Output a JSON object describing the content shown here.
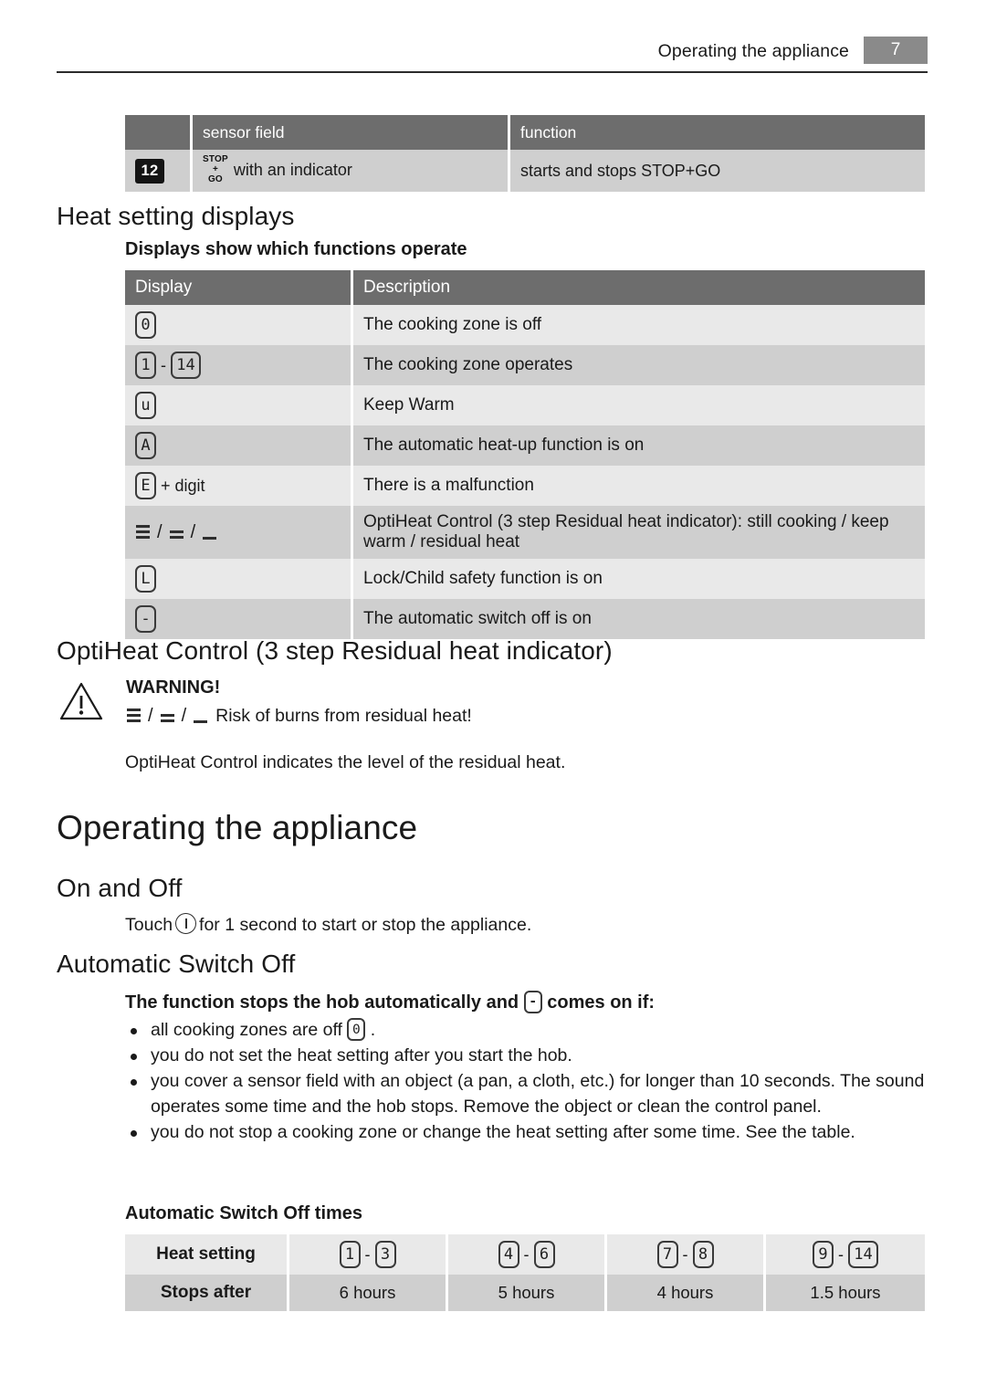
{
  "running_header": {
    "title": "Operating the appliance",
    "page_number": "7"
  },
  "sensor_table": {
    "headers": [
      "",
      "sensor field",
      "function"
    ],
    "rows": [
      {
        "number": "12",
        "icon": "stop-go-icon",
        "icon_lines": [
          "STOP",
          "+",
          "GO"
        ],
        "field_text": "with an indicator",
        "function": "starts and stops STOP+GO"
      }
    ]
  },
  "heat_setting_displays": {
    "heading": "Heat setting displays",
    "subheading": "Displays show which functions operate",
    "table": {
      "headers": [
        "Display",
        "Description"
      ],
      "rows": [
        {
          "display": "0",
          "description": "The cooking zone is off"
        },
        {
          "display_from": "1",
          "display_to": "14",
          "separator": "-",
          "description": "The cooking zone operates"
        },
        {
          "display": "u",
          "description": "Keep Warm"
        },
        {
          "display": "A",
          "description": "The automatic heat-up function is on"
        },
        {
          "display": "E",
          "display_suffix": "+ digit",
          "description": "There is a malfunction"
        },
        {
          "display_bars": [
            "3-bar",
            "2-bar",
            "1-bar"
          ],
          "description": "OptiHeat Control (3 step Residual heat indicator): still cooking / keep warm / residual heat"
        },
        {
          "display": "L",
          "description": "Lock/Child safety function is on"
        },
        {
          "display": "-",
          "description": "The automatic switch off is on"
        }
      ]
    }
  },
  "optiheat": {
    "heading": "OptiHeat Control (3 step Residual heat indicator)",
    "warning_label": "WARNING!",
    "warning_icon": "warning-triangle-icon",
    "warning_bars": [
      "3-bar",
      "2-bar",
      "1-bar"
    ],
    "warning_text": "Risk of burns from residual heat!",
    "body": "OptiHeat Control indicates the level of the residual heat."
  },
  "operating_chapter": {
    "title": "Operating the appliance"
  },
  "on_and_off": {
    "heading": "On and Off",
    "text_before": "Touch",
    "icon": "power-icon",
    "text_after": "for 1 second to start or stop the appliance."
  },
  "automatic_switch_off": {
    "heading": "Automatic Switch Off",
    "lead_before": "The function stops the hob automatically and",
    "lead_display": "-",
    "lead_after": "comes on if:",
    "bullets": [
      {
        "before": "all cooking zones are off",
        "display": "0",
        "after": "."
      },
      {
        "text": "you do not set the heat setting after you start the hob."
      },
      {
        "text": "you cover a sensor field with an object (a pan, a cloth, etc.) for longer than 10 seconds. The sound operates some time and the hob stops. Remove the object or clean the control panel."
      },
      {
        "text": "you do not stop a cooking zone or change the heat setting after some time. See the table."
      }
    ],
    "times_heading": "Automatic Switch Off times",
    "times_table": {
      "row_labels": [
        "Heat setting",
        "Stops after"
      ],
      "columns": [
        {
          "from": "1",
          "to": "3",
          "stops_after": "6 hours"
        },
        {
          "from": "4",
          "to": "6",
          "stops_after": "5 hours"
        },
        {
          "from": "7",
          "to": "8",
          "stops_after": "4 hours"
        },
        {
          "from": "9",
          "to": "14",
          "stops_after": "1.5 hours"
        }
      ],
      "separator": "-"
    }
  },
  "colors": {
    "header_gray": "#6d6d6d",
    "row_light": "#e9e9e9",
    "row_dark": "#cfcfcf",
    "page_badge": "#8a8a8a",
    "text": "#1a1a1a"
  }
}
